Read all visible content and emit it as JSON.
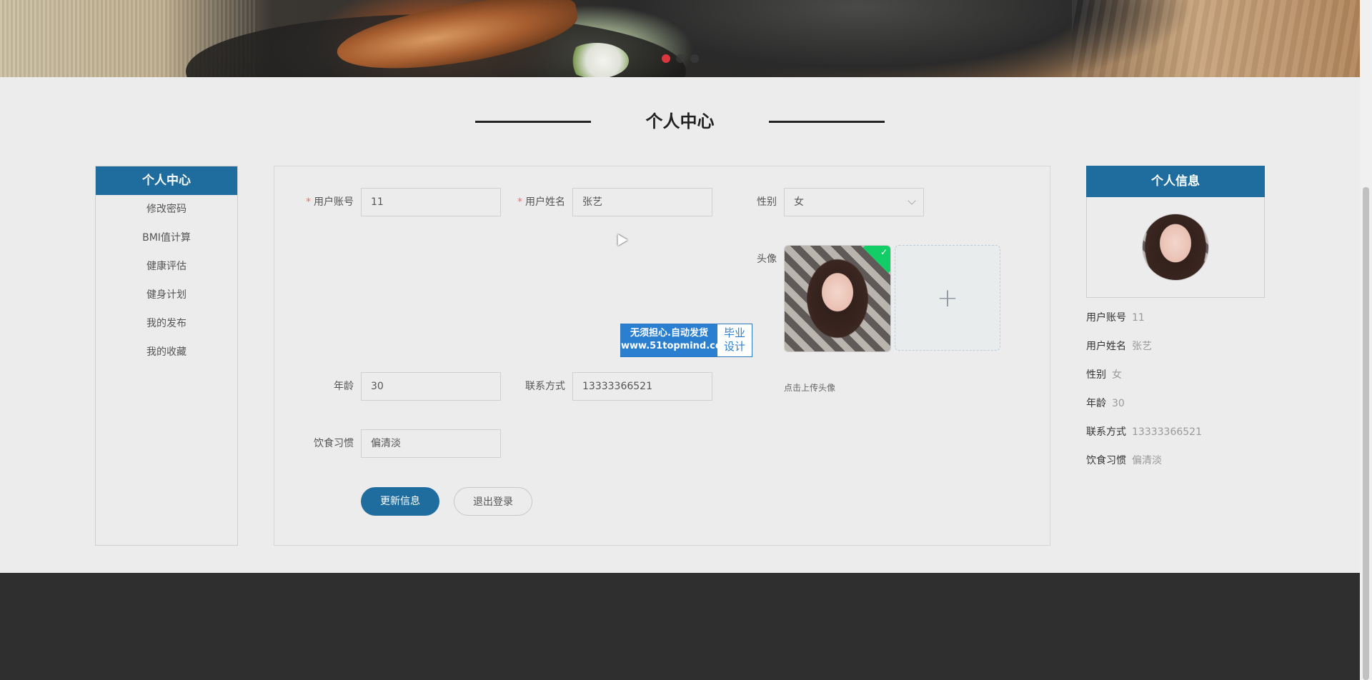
{
  "section": {
    "title": "个人中心"
  },
  "left_menu": {
    "title": "个人中心",
    "items": [
      "修改密码",
      "BMI值计算",
      "健康评估",
      "健身计划",
      "我的发布",
      "我的收藏"
    ]
  },
  "form": {
    "account_label": "用户账号",
    "account_value": "11",
    "name_label": "用户姓名",
    "name_value": "张艺",
    "gender_label": "性别",
    "gender_value": "女",
    "avatar_label": "头像",
    "upload_hint": "点击上传头像",
    "age_label": "年龄",
    "age_value": "30",
    "contact_label": "联系方式",
    "contact_value": "13333366521",
    "diet_label": "饮食习惯",
    "diet_value": "偏清淡",
    "required_mark": "*",
    "update_button": "更新信息",
    "logout_button": "退出登录"
  },
  "watermark": {
    "line1": "无须担心.自动发货",
    "line2": "www.51topmind.com",
    "badge1": "毕业",
    "badge2": "设计"
  },
  "profile": {
    "title": "个人信息",
    "rows": [
      {
        "k": "用户账号",
        "v": "11"
      },
      {
        "k": "用户姓名",
        "v": "张艺"
      },
      {
        "k": "性别",
        "v": "女"
      },
      {
        "k": "年龄",
        "v": "30"
      },
      {
        "k": "联系方式",
        "v": "13333366521"
      },
      {
        "k": "饮食习惯",
        "v": "偏清淡"
      }
    ]
  },
  "carousel": {
    "dot_count": 3,
    "active_index": 0,
    "accent": "#d9363e"
  },
  "colors": {
    "primary": "#1f6d9e",
    "footer": "#2f2f2f",
    "success": "#13ce66"
  }
}
